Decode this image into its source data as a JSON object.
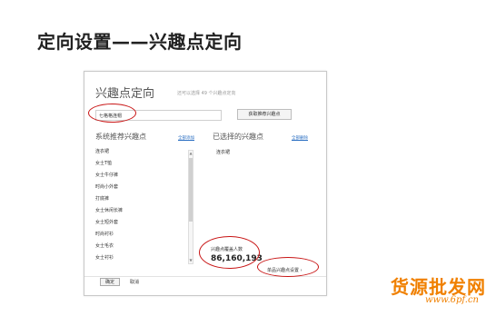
{
  "slide": {
    "title": "定向设置——兴趣点定向"
  },
  "panel": {
    "title": "兴趣点定向",
    "hint": "还可以选择 49 个兴趣点定向",
    "search_value": "七格格连帽",
    "get_button": "获取推荐兴趣点",
    "left_header": "系统推荐兴趣点",
    "left_action": "全部添加",
    "right_header": "已选择的兴趣点",
    "right_action": "全部删除",
    "recommended": [
      "连衣裙",
      "女士T恤",
      "女士牛仔裤",
      "时尚小外套",
      "打底裤",
      "女士休闲长裤",
      "女士短外套",
      "时尚衬衫",
      "女士毛衣",
      "女士衬衫"
    ],
    "selected": [
      "连衣裙"
    ],
    "reach_label": "兴趣点覆盖人数",
    "reach_value": "86,160,193",
    "detail_link": "单品兴趣点设置 ›",
    "ok_button": "确定",
    "cancel": "取消"
  },
  "watermark": {
    "text": "货源批发网",
    "url": "www.6pf.cn"
  },
  "colors": {
    "highlight": "#c81414",
    "link": "#2b6fc2",
    "watermark": "#f08000"
  }
}
